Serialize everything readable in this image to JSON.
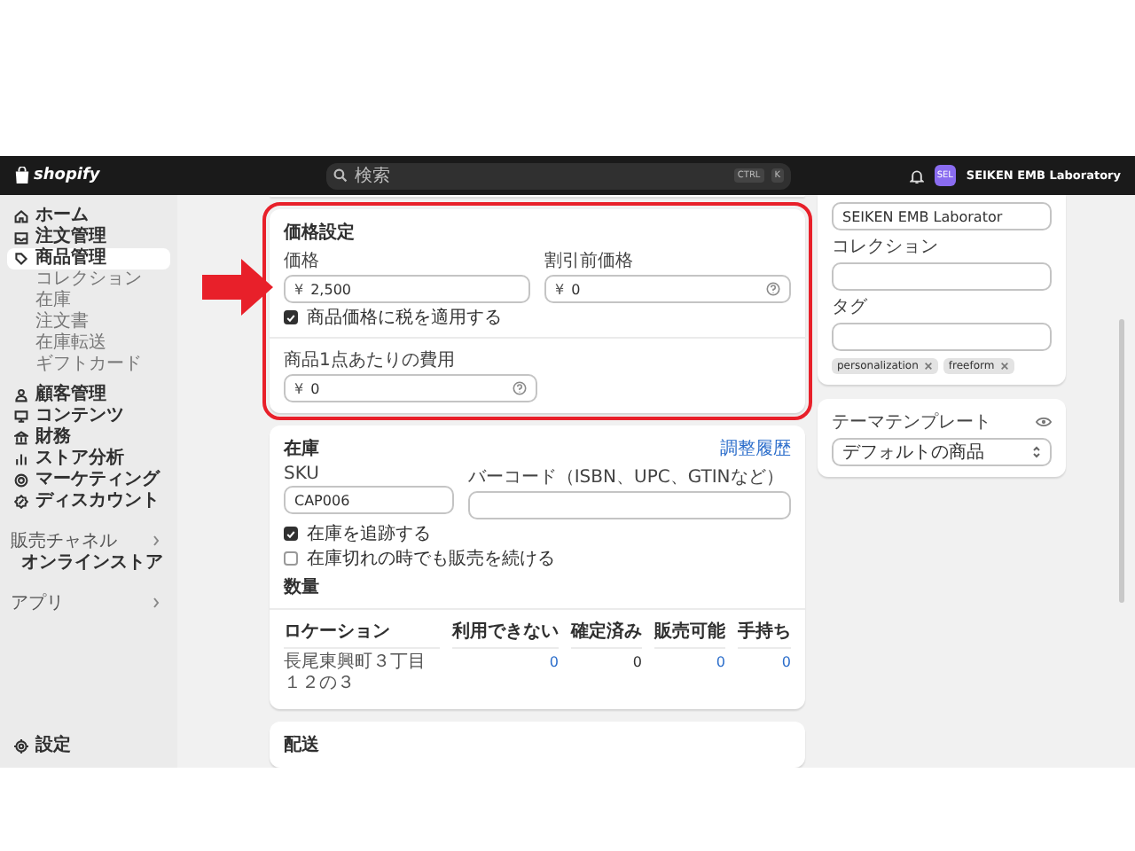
{
  "topbar": {
    "logo": "shopify",
    "search": {
      "placeholder": "検索",
      "keys": [
        "CTRL",
        "K"
      ]
    },
    "avatar": "SEL",
    "store": "SEIKEN EMB Laboratory"
  },
  "sidebar": {
    "groups": [
      [
        {
          "label": "ホーム",
          "kind": "home",
          "selected": false
        },
        {
          "label": "注文管理",
          "kind": "orders",
          "selected": false
        },
        {
          "label": "商品管理",
          "kind": "products",
          "selected": true,
          "children": [
            {
              "label": "コレクション"
            },
            {
              "label": "在庫"
            },
            {
              "label": "注文書"
            },
            {
              "label": "在庫転送"
            },
            {
              "label": "ギフトカード"
            }
          ]
        }
      ],
      [
        {
          "label": "顧客管理",
          "kind": "customers",
          "selected": false
        },
        {
          "label": "コンテンツ",
          "kind": "content",
          "selected": false
        },
        {
          "label": "財務",
          "kind": "finance",
          "selected": false
        },
        {
          "label": "ストア分析",
          "kind": "analytics",
          "selected": false
        },
        {
          "label": "マーケティング",
          "kind": "marketing",
          "selected": false
        },
        {
          "label": "ディスカウント",
          "kind": "discounts",
          "selected": false
        }
      ]
    ],
    "sections": [
      {
        "title": "販売チャネル",
        "items": [
          {
            "label": "オンラインストア",
            "kind": "store",
            "selected": false
          }
        ]
      },
      {
        "title": "アプリ"
      }
    ],
    "settings": {
      "label": "設定",
      "kind": "settings",
      "selected": false
    }
  },
  "pricing": {
    "title": "価格設定",
    "highlighted": true,
    "fields": [
      {
        "label": "価格",
        "prefix": "¥",
        "value": "2,500",
        "help": false
      },
      {
        "label": "割引前価格",
        "prefix": "¥",
        "value": "0",
        "help": true
      }
    ],
    "tax": {
      "label": "商品価格に税を適用する",
      "checked": true
    },
    "cost": {
      "label": "商品1点あたりの費用",
      "prefix": "¥",
      "value": "0",
      "help": true
    }
  },
  "inventory": {
    "title": "在庫",
    "link": "調整履歴",
    "sku": {
      "label": "SKU",
      "value": "CAP006"
    },
    "barcode": {
      "label": "バーコード（ISBN、UPC、GTINなど）"
    },
    "options": [
      {
        "label": "在庫を追跡する",
        "checked": true
      },
      {
        "label": "在庫切れの時でも販売を続ける",
        "checked": false
      }
    ],
    "quantity_title": "数量",
    "columns": [
      "ロケーション",
      "利用できない",
      "確定済み",
      "販売可能",
      "手持ち"
    ],
    "rows": [
      {
        "cells": [
          {
            "value": "長尾東興町３丁目１２の３",
            "link": false
          },
          {
            "value": "0",
            "link": true
          },
          {
            "value": "0",
            "link": false
          },
          {
            "value": "0",
            "link": true
          },
          {
            "value": "0",
            "link": true
          }
        ]
      }
    ]
  },
  "shipping": {
    "title": "配送"
  },
  "organization": {
    "vendor": "SEIKEN EMB Laborator",
    "fields": [
      {
        "label": "コレクション"
      },
      {
        "label": "タグ"
      }
    ],
    "tags": [
      "personalization",
      "freeform"
    ]
  },
  "template": {
    "label": "テーマテンプレート",
    "value": "デフォルトの商品"
  }
}
